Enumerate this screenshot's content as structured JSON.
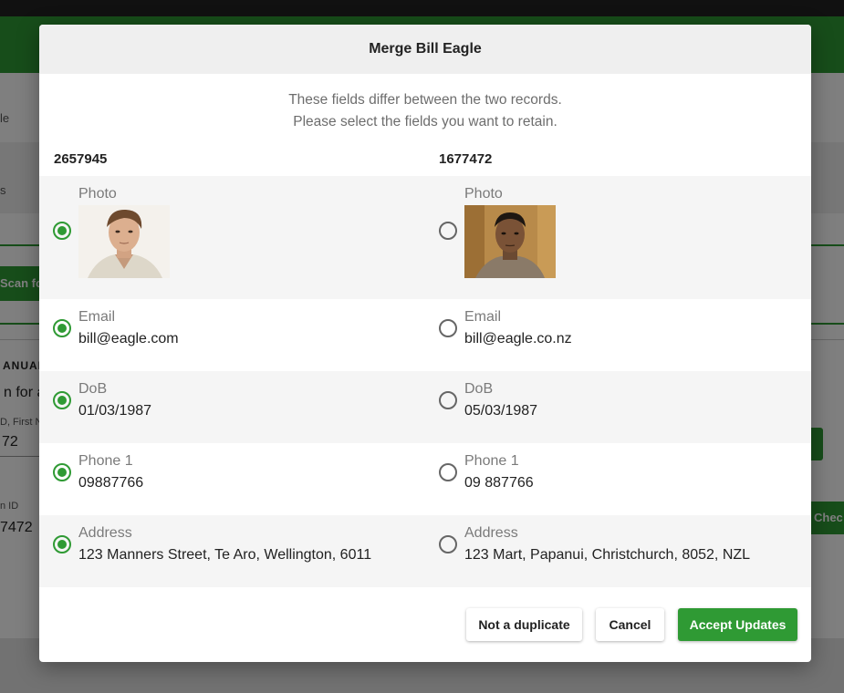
{
  "background": {
    "frag_title": "le",
    "frag_tab": "s",
    "scan_button": "Scan fo",
    "manual_heading": "ANUAL",
    "search_text": "n for a",
    "field_hint": "D, First N",
    "field_value": "72",
    "id_label": "n ID",
    "id_value": "7472",
    "check_button": "Chec"
  },
  "dialog": {
    "title": "Merge Bill Eagle",
    "intro_line1": "These fields differ between the two records.",
    "intro_line2": "Please select the fields you want to retain.",
    "left_id": "2657945",
    "right_id": "1677472",
    "fields": [
      {
        "label": "Photo",
        "left": "",
        "right": "",
        "selected": "left",
        "type": "photo"
      },
      {
        "label": "Email",
        "left": "bill@eagle.com",
        "right": "bill@eagle.co.nz",
        "selected": "left"
      },
      {
        "label": "DoB",
        "left": "01/03/1987",
        "right": "05/03/1987",
        "selected": "left"
      },
      {
        "label": "Phone 1",
        "left": "09887766",
        "right": "09 887766",
        "selected": "left"
      },
      {
        "label": "Address",
        "left": "123 Manners Street, Te Aro, Wellington, 6011",
        "right": "123 Mart, Papanui, Christchurch, 8052, NZL",
        "selected": "left"
      }
    ],
    "buttons": {
      "not_duplicate": "Not a duplicate",
      "cancel": "Cancel",
      "accept": "Accept Updates"
    }
  },
  "colors": {
    "accent": "#2f9a34",
    "header_bg": "#efefef",
    "row_shade": "#f5f5f5"
  }
}
